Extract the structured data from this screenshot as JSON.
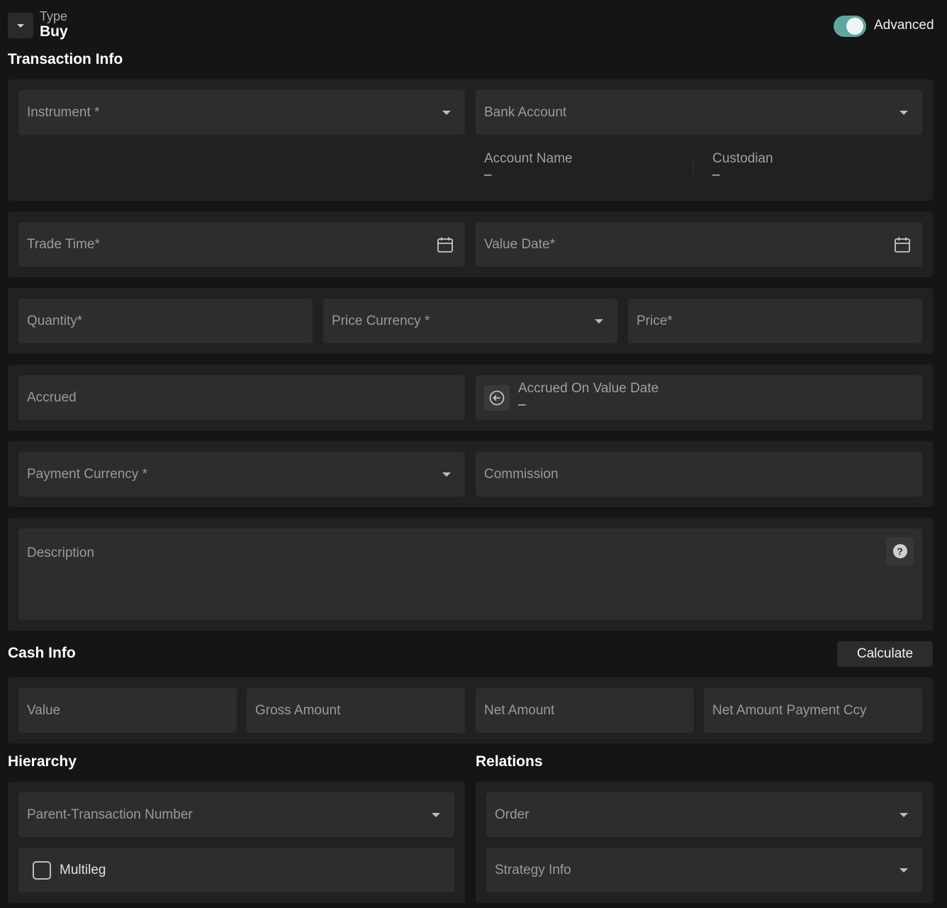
{
  "header": {
    "type_label": "Type",
    "type_value": "Buy",
    "advanced_label": "Advanced",
    "advanced_on": true
  },
  "transaction_info": {
    "title": "Transaction Info",
    "instrument": "Instrument *",
    "bank_account": "Bank Account",
    "account_name_label": "Account Name",
    "account_name_value": "–",
    "custodian_label": "Custodian",
    "custodian_value": "–",
    "trade_time": "Trade Time*",
    "value_date": "Value Date*",
    "quantity": "Quantity*",
    "price_currency": "Price Currency *",
    "price": "Price*",
    "accrued": "Accrued",
    "accrued_on_value_date_label": "Accrued On Value Date",
    "accrued_on_value_date_value": "–",
    "payment_currency": "Payment Currency *",
    "commission": "Commission",
    "description": "Description"
  },
  "cash_info": {
    "title": "Cash Info",
    "calculate_label": "Calculate",
    "value": "Value",
    "gross_amount": "Gross Amount",
    "net_amount": "Net Amount",
    "net_amount_payment_ccy": "Net Amount Payment Ccy"
  },
  "hierarchy": {
    "title": "Hierarchy",
    "parent_transaction_number": "Parent-Transaction Number",
    "multileg": "Multileg"
  },
  "relations": {
    "title": "Relations",
    "order": "Order",
    "strategy_info": "Strategy Info"
  },
  "colors": {
    "background": "#151515",
    "panel": "#212121",
    "field": "#2d2d2d",
    "toggle_on": "#5fa6a0"
  }
}
